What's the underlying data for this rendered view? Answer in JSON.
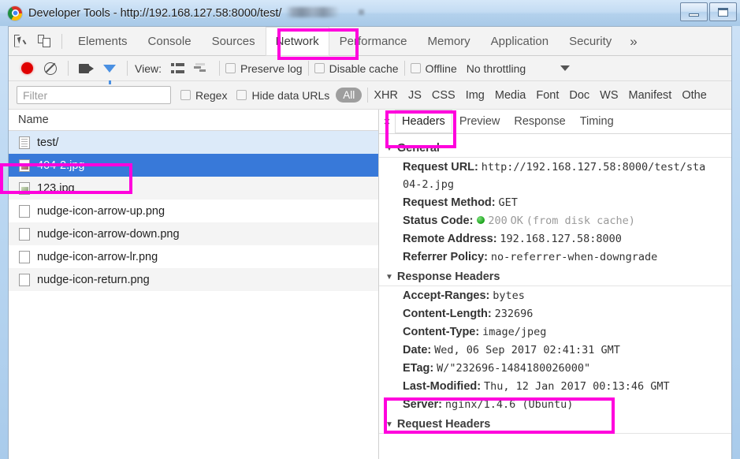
{
  "window": {
    "title": "Developer Tools - http://192.168.127.58:8000/test/",
    "minimize_label": "Minimize",
    "maximize_label": "Maximize"
  },
  "devtools": {
    "tabs": [
      {
        "label": "Elements",
        "selected": false
      },
      {
        "label": "Console",
        "selected": false
      },
      {
        "label": "Sources",
        "selected": false
      },
      {
        "label": "Network",
        "selected": true
      },
      {
        "label": "Performance",
        "selected": false
      },
      {
        "label": "Memory",
        "selected": false
      },
      {
        "label": "Application",
        "selected": false
      },
      {
        "label": "Security",
        "selected": false
      }
    ],
    "more_tabs_label": "»"
  },
  "network_toolbar": {
    "view_label": "View:",
    "preserve_log_label": "Preserve log",
    "disable_cache_label": "Disable cache",
    "offline_label": "Offline",
    "throttling_value": "No throttling"
  },
  "filter_bar": {
    "filter_placeholder": "Filter",
    "filter_value": "",
    "regex_label": "Regex",
    "hide_data_urls_label": "Hide data URLs",
    "all_label": "All",
    "types": [
      "XHR",
      "JS",
      "CSS",
      "Img",
      "Media",
      "Font",
      "Doc",
      "WS",
      "Manifest",
      "Othe"
    ]
  },
  "requests": {
    "column_header": "Name",
    "rows": [
      {
        "name": "test/",
        "icon": "document-icon",
        "state": "loaded"
      },
      {
        "name": "404-2.jpg",
        "icon": "image-icon",
        "state": "selected"
      },
      {
        "name": "123.jpg",
        "icon": "image-icon",
        "state": "zebra"
      },
      {
        "name": "nudge-icon-arrow-up.png",
        "icon": "image-icon",
        "state": "normal"
      },
      {
        "name": "nudge-icon-arrow-down.png",
        "icon": "image-icon",
        "state": "zebra"
      },
      {
        "name": "nudge-icon-arrow-lr.png",
        "icon": "image-icon",
        "state": "normal"
      },
      {
        "name": "nudge-icon-return.png",
        "icon": "image-icon",
        "state": "zebra"
      }
    ]
  },
  "details": {
    "close_label": "×",
    "tabs": [
      {
        "label": "Headers",
        "selected": true
      },
      {
        "label": "Preview",
        "selected": false
      },
      {
        "label": "Response",
        "selected": false
      },
      {
        "label": "Timing",
        "selected": false
      }
    ],
    "general": {
      "section_title": "General",
      "request_url_key": "Request URL:",
      "request_url_value": "http://192.168.127.58:8000/test/sta",
      "request_url_value_wrap": "04-2.jpg",
      "request_method_key": "Request Method:",
      "request_method_value": "GET",
      "status_code_key": "Status Code:",
      "status_code_value": "200",
      "status_code_text": "OK",
      "status_code_note": "(from disk cache)",
      "remote_address_key": "Remote Address:",
      "remote_address_value": "192.168.127.58:8000",
      "referrer_policy_key": "Referrer Policy:",
      "referrer_policy_value": "no-referrer-when-downgrade"
    },
    "response_headers": {
      "section_title": "Response Headers",
      "items": [
        {
          "key": "Accept-Ranges:",
          "value": "bytes"
        },
        {
          "key": "Content-Length:",
          "value": "232696"
        },
        {
          "key": "Content-Type:",
          "value": "image/jpeg"
        },
        {
          "key": "Date:",
          "value": "Wed, 06 Sep 2017 02:41:31 GMT"
        },
        {
          "key": "ETag:",
          "value": "W/\"232696-1484180026000\""
        },
        {
          "key": "Last-Modified:",
          "value": "Thu, 12 Jan 2017 00:13:46 GMT"
        },
        {
          "key": "Server:",
          "value": "nginx/1.4.6 (Ubuntu)"
        }
      ]
    },
    "request_headers": {
      "section_title": "Request Headers"
    }
  },
  "annotations": {
    "color": "#ff00dd",
    "boxes": [
      "network-tab",
      "selected-request-row",
      "headers-tab",
      "server-header"
    ]
  }
}
